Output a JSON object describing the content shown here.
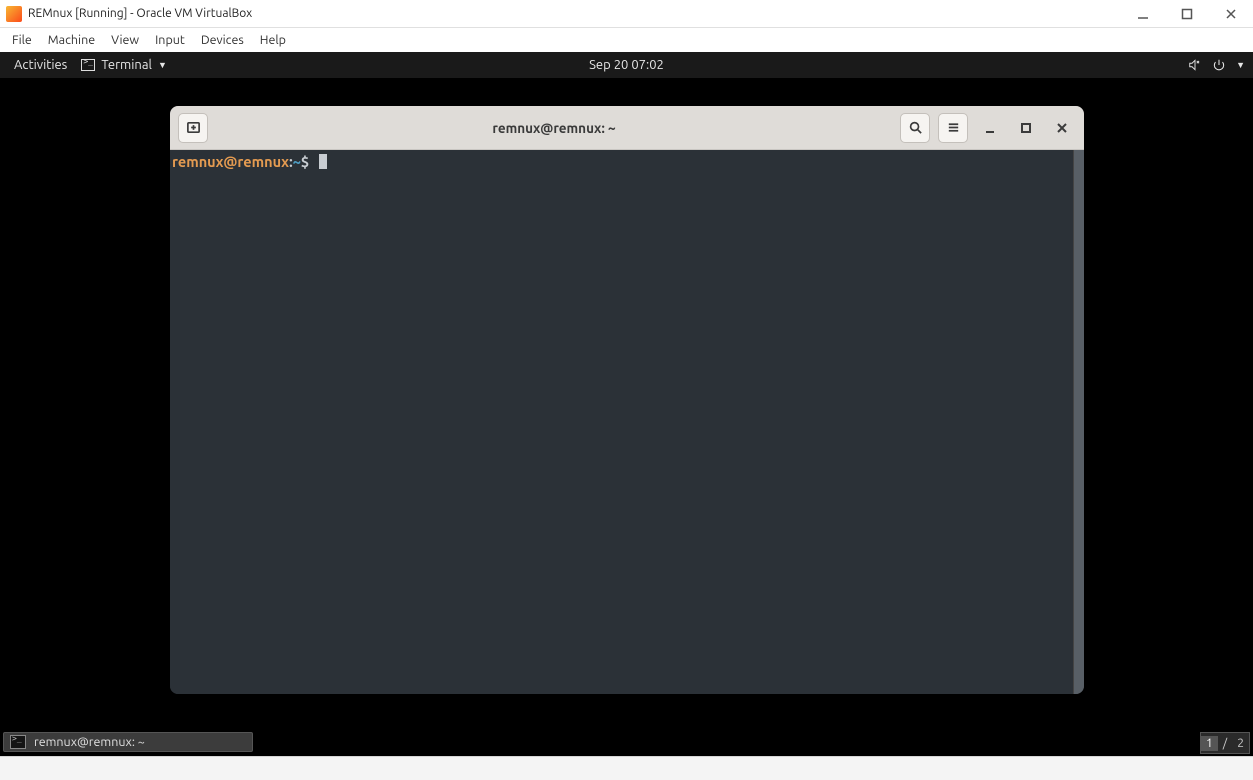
{
  "host": {
    "window_title": "REMnux [Running] - Oracle VM VirtualBox",
    "menu": {
      "file": "File",
      "machine": "Machine",
      "view": "View",
      "input": "Input",
      "devices": "Devices",
      "help": "Help"
    }
  },
  "gnome": {
    "activities_label": "Activities",
    "app_menu_label": "Terminal",
    "clock": "Sep 20  07:02",
    "dock_item_label": "remnux@remnux: ~",
    "pager": {
      "current": "1",
      "sep": "/",
      "total": "2"
    }
  },
  "terminal": {
    "window_title": "remnux@remnux: ~",
    "prompt": {
      "user_host": "remnux@remnux",
      "separator": ":",
      "path": "~",
      "symbol": "$"
    }
  },
  "icons": {
    "new_tab": "new-tab-icon",
    "search": "search-icon",
    "menu": "hamburger-icon",
    "minimize": "window-minimize-icon",
    "maximize": "window-maximize-icon",
    "close": "window-close-icon",
    "sound_mute": "speaker-mute-icon",
    "power": "power-icon"
  }
}
